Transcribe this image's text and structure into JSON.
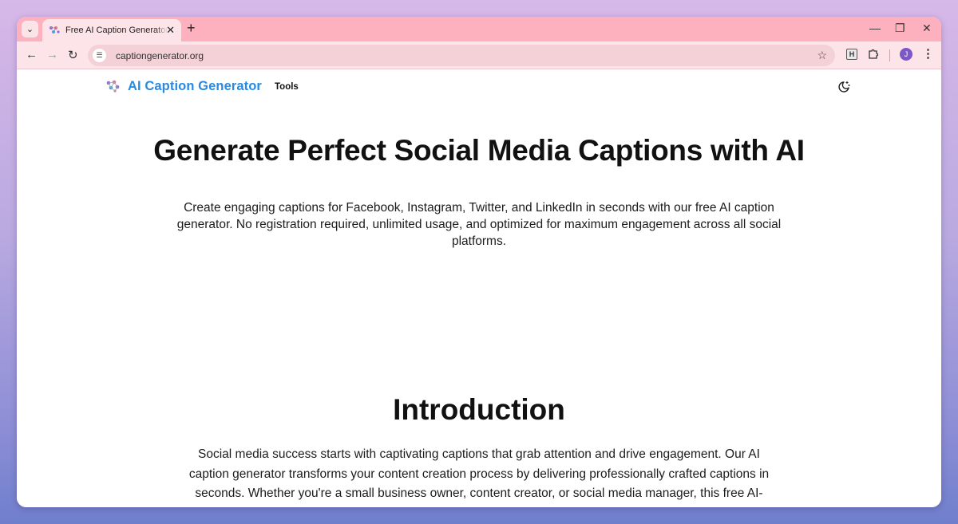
{
  "browser": {
    "tab_title": "Free AI Caption Generator for Social Media",
    "url": "captiongenerator.org",
    "avatar_letter": "J",
    "extension_letter": "H"
  },
  "header": {
    "logo_text": "AI Caption Generator",
    "nav_tools": "Tools"
  },
  "hero": {
    "title": "Generate Perfect Social Media Captions with AI",
    "subtitle": "Create engaging captions for Facebook, Instagram, Twitter, and LinkedIn in seconds with our free AI caption generator. No registration required, unlimited usage, and optimized for maximum engagement across all social platforms."
  },
  "intro": {
    "title": "Introduction",
    "body": "Social media success starts with captivating captions that grab attention and drive engagement. Our AI caption generator transforms your content creation process by delivering professionally crafted captions in seconds. Whether you're a small business owner, content creator, or social media manager, this free AI-powered tool eliminates creative blocks and saves hours of writing time."
  },
  "colors": {
    "brand": "#2a8ae0",
    "tabstrip": "#fdb0bd",
    "toolbar": "#fde4e8",
    "avatar": "#7b57c8"
  },
  "icons": {
    "tab_search": "chevron-down-icon",
    "close": "close-icon",
    "new_tab": "plus-icon",
    "back": "arrow-left-icon",
    "forward": "arrow-right-icon",
    "reload": "reload-icon",
    "site_info": "tune-icon",
    "bookmark": "star-icon",
    "extensions": "puzzle-icon",
    "menu": "kebab-icon",
    "theme": "moon-stars-icon",
    "logo": "brain-network-icon"
  }
}
